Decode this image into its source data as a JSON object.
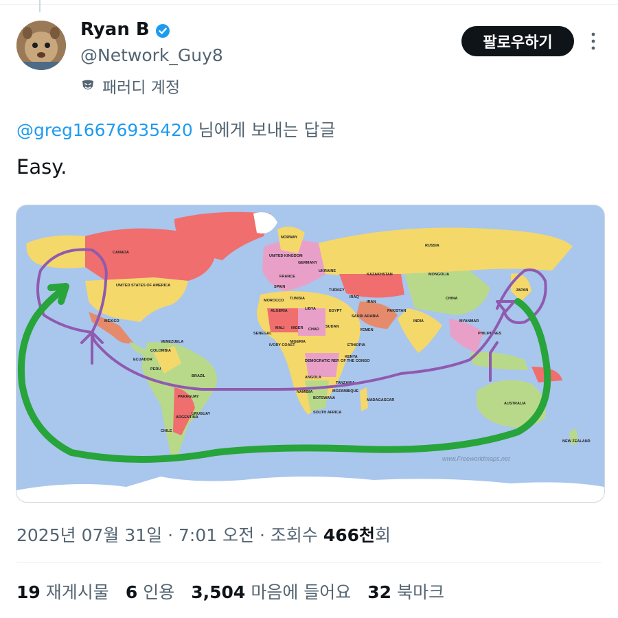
{
  "author": {
    "name": "Ryan B",
    "handle": "@Network_Guy8",
    "parody_label": "패러디 계정"
  },
  "actions": {
    "follow_label": "팔로우하기"
  },
  "reply": {
    "mention": "@greg16676935420",
    "suffix": " 님에게 보내는 답글"
  },
  "post": {
    "text": "Easy."
  },
  "media": {
    "map_labels": {
      "russia": "RUSSIA",
      "canada": "CANADA",
      "usa": "UNITED STATES OF AMERICA",
      "mexico": "MEXICO",
      "brazil": "BRAZIL",
      "china": "CHINA",
      "india": "INDIA",
      "australia": "AUSTRALIA",
      "japan": "JAPAN",
      "mongolia": "MONGOLIA",
      "kazakhstan": "KAZAKHSTAN",
      "algeria": "ALGERIA",
      "libya": "LIBYA",
      "egypt": "EGYPT",
      "sudan": "SUDAN",
      "chad": "CHAD",
      "niger": "NIGER",
      "mali": "MALI",
      "nigeria": "NIGERIA",
      "ethiopia": "ETHIOPIA",
      "drc": "DEMOCRATIC REP. OF THE CONGO",
      "angola": "ANGOLA",
      "namibia": "NAMIBIA",
      "botswana": "BOTSWANA",
      "south_africa": "SOUTH AFRICA",
      "madagascar": "MADAGASCAR",
      "new_zealand": "NEW ZEALAND",
      "argentina": "ARGENTINA",
      "chile": "CHILE",
      "peru": "PERU",
      "colombia": "COLOMBIA",
      "venezuela": "VENEZUELA",
      "ecuador": "ECUADOR",
      "paraguay": "PARAGUAY",
      "uruguay": "URUGUAY",
      "norway": "NORWAY",
      "ukraine": "UKRAINE",
      "turkey": "TURKEY",
      "iran": "IRAN",
      "iraq": "IRAQ",
      "saudi": "SAUDI ARABIA",
      "pakistan": "PAKISTAN",
      "philippines": "PHILIPPINES",
      "tanzania": "TANZANIA",
      "kenya": "KENYA",
      "mozambique": "MOZAMBIQUE",
      "spain": "SPAIN",
      "france": "FRANCE",
      "uk": "UNITED KINGDOM",
      "senegal": "SENEGAL",
      "morocco": "MOROCCO",
      "yemen": "YEMEN",
      "myanmar": "MYANMAR",
      "tunisia": "TUNISIA",
      "ivory": "IVORY COAST",
      "germany": "GERMANY",
      "watermark": "www.Freeworldmaps.net"
    }
  },
  "meta": {
    "date": "2025년 07월 31일",
    "sep1": " · ",
    "time": "7:01 오전",
    "sep2": " · ",
    "views_label": "조회수 ",
    "views_value": "466천",
    "views_suffix": "회"
  },
  "stats": {
    "retweets_value": "19",
    "retweets_label": "재게시물",
    "quotes_value": "6",
    "quotes_label": "인용",
    "likes_value": "3,504",
    "likes_label": "마음에 들어요",
    "bookmarks_value": "32",
    "bookmarks_label": "북마크"
  },
  "colors": {
    "accent": "#1d9bf0",
    "ocean": "#a9c6ec",
    "route_purple": "#8f5ab0",
    "route_green": "#27a43a"
  }
}
